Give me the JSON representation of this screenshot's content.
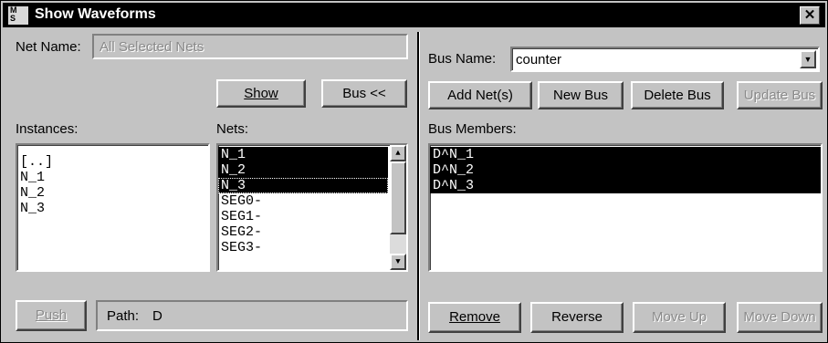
{
  "window": {
    "title": "Show Waveforms",
    "icon_text_top": "M",
    "icon_text_bottom": "S",
    "close_glyph": "✕"
  },
  "left": {
    "net_name_label": "Net Name:",
    "net_name_value": "All Selected Nets",
    "show_button": "Show",
    "bus_button": "Bus <<",
    "instances_label": "Instances:",
    "nets_label": "Nets:",
    "instances": [
      "[..]",
      "N_1",
      "N_2",
      "N_3"
    ],
    "nets": [
      {
        "label": "N_1",
        "selected": true
      },
      {
        "label": "N_2",
        "selected": true
      },
      {
        "label": "N_3",
        "selected": true
      },
      {
        "label": "SEG0-",
        "selected": false
      },
      {
        "label": "SEG1-",
        "selected": false
      },
      {
        "label": "SEG2-",
        "selected": false
      },
      {
        "label": "SEG3-",
        "selected": false
      }
    ],
    "push_button": "Push",
    "path_label": "Path:",
    "path_value": "D"
  },
  "right": {
    "bus_name_label": "Bus Name:",
    "bus_name_value": "counter",
    "add_net_button": "Add Net(s)",
    "new_bus_button": "New Bus",
    "delete_bus_button": "Delete Bus",
    "update_bus_button": "Update Bus",
    "bus_members_label": "Bus Members:",
    "bus_members": [
      "D^N_1",
      "D^N_2",
      "D^N_3"
    ],
    "remove_button": "Remove",
    "reverse_button": "Reverse",
    "move_up_button": "Move Up",
    "move_down_button": "Move Down"
  },
  "icons": {
    "scroll_up": "▲",
    "scroll_down": "▼",
    "combo_down": "▼"
  }
}
